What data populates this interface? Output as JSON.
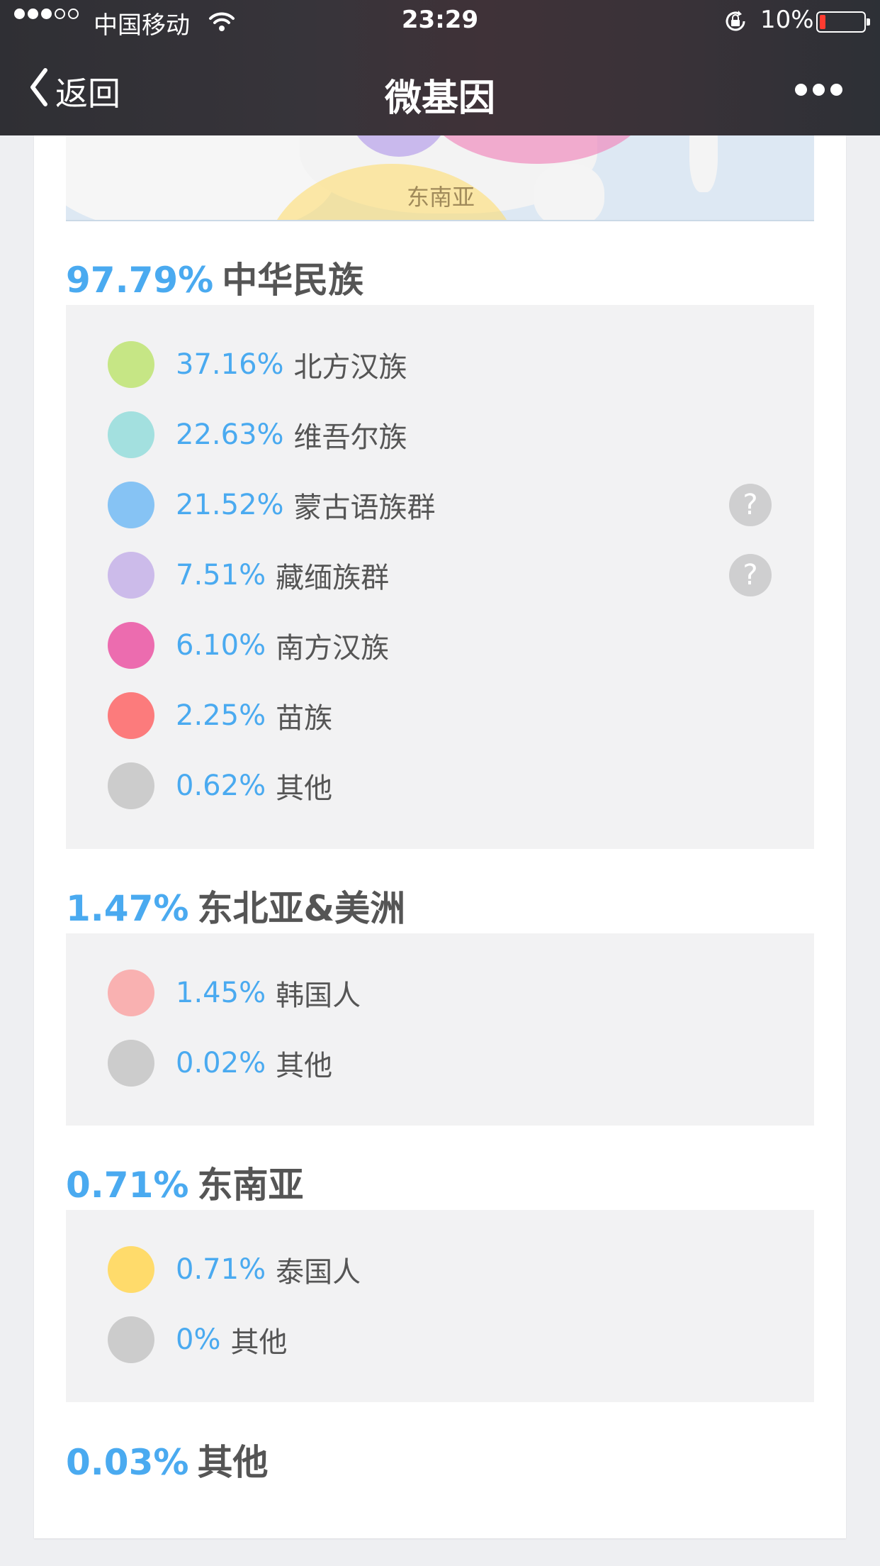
{
  "status_bar": {
    "carrier": "中国移动",
    "time": "23:29",
    "battery": "10%"
  },
  "nav": {
    "back_label": "返回",
    "title": "微基因"
  },
  "map": {
    "region_label": "东南亚"
  },
  "sections": [
    {
      "percent": "97.79%",
      "name": "中华民族",
      "items": [
        {
          "percent": "37.16%",
          "name": "北方汉族",
          "color": "#c6e685"
        },
        {
          "percent": "22.63%",
          "name": "维吾尔族",
          "color": "#a3e0df"
        },
        {
          "percent": "21.52%",
          "name": "蒙古语族群",
          "color": "#86c3f4"
        },
        {
          "percent": "7.51%",
          "name": "藏缅族群",
          "color": "#ccbbea"
        },
        {
          "percent": "6.10%",
          "name": "南方汉族",
          "color": "#ec6caf"
        },
        {
          "percent": "2.25%",
          "name": "苗族",
          "color": "#fc7b7c"
        },
        {
          "percent": "0.62%",
          "name": "其他",
          "color": "#cccccc"
        }
      ]
    },
    {
      "percent": "1.47%",
      "name": "东北亚&美洲",
      "items": [
        {
          "percent": "1.45%",
          "name": "韩国人",
          "color": "#f9b1b1"
        },
        {
          "percent": "0.02%",
          "name": "其他",
          "color": "#cccccc"
        }
      ]
    },
    {
      "percent": "0.71%",
      "name": "东南亚",
      "items": [
        {
          "percent": "0.71%",
          "name": "泰国人",
          "color": "#ffdb6b"
        },
        {
          "percent": "0%",
          "name": "其他",
          "color": "#cccccc"
        }
      ]
    },
    {
      "percent": "0.03%",
      "name": "其他",
      "items": []
    }
  ],
  "help_icon_glyph": "?"
}
